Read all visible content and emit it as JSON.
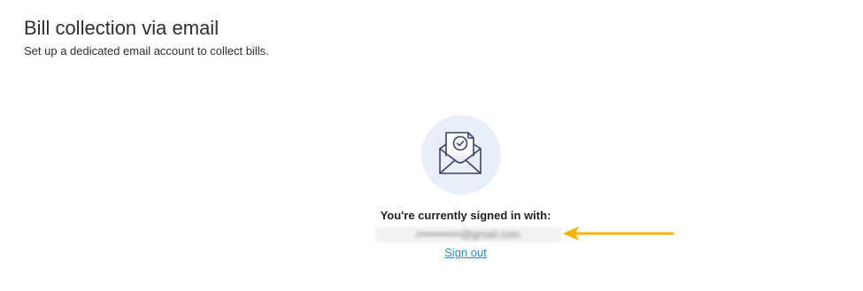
{
  "header": {
    "title": "Bill collection via email",
    "subtitle": "Set up a dedicated email account to collect bills."
  },
  "account": {
    "icon": "envelope-document-check-icon",
    "signed_in_label": "You're currently signed in with:",
    "email": "r•••••••••••@gmail.com",
    "sign_out_label": "Sign out"
  },
  "annotation": {
    "icon": "arrow-left-icon",
    "color": "#f5b400"
  },
  "colors": {
    "link": "#2a8fcb",
    "badge_bg": "#e9eef8",
    "icon_stroke": "#3b4466"
  }
}
